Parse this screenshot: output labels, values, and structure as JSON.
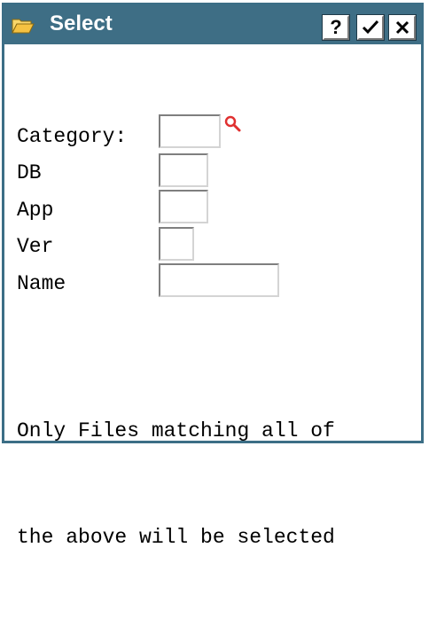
{
  "window": {
    "title": "Select",
    "icons": {
      "title": "folder-icon",
      "help": "help-icon",
      "ok": "checkmark-icon",
      "close": "close-icon",
      "lookup": "search-icon"
    },
    "help_glyph": "?",
    "colors": {
      "titlebar": "#3e6e85",
      "border": "#3c6e86",
      "folder": "#f5c242",
      "search_icon": "#e03030"
    }
  },
  "form": {
    "fields": [
      {
        "label": "Category:",
        "value": ""
      },
      {
        "label": "DB",
        "value": ""
      },
      {
        "label": "App",
        "value": ""
      },
      {
        "label": "Ver",
        "value": ""
      },
      {
        "label": "Name",
        "value": ""
      }
    ]
  },
  "note": {
    "line1": "Only Files matching all of",
    "line2": "the above will be selected"
  }
}
